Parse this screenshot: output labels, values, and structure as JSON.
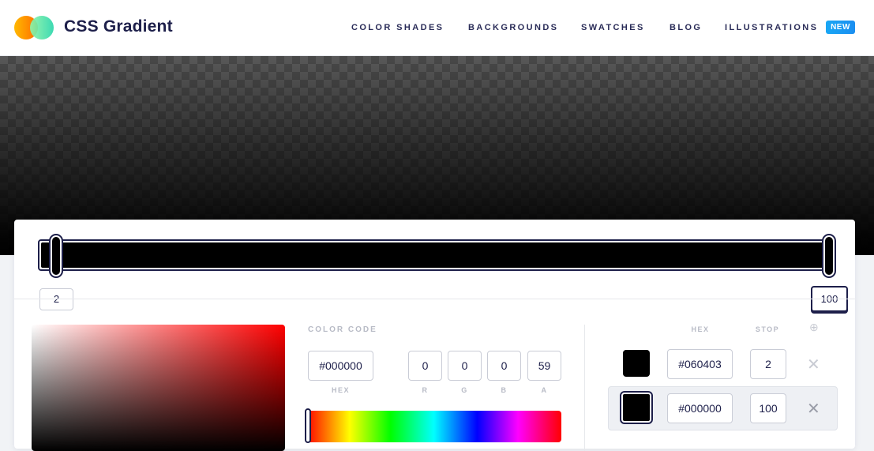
{
  "header": {
    "brand": "CSS Gradient",
    "nav": [
      "COLOR SHADES",
      "BACKGROUNDS",
      "SWATCHES",
      "BLOG",
      "ILLUSTRATIONS"
    ],
    "badge": "NEW"
  },
  "slider": {
    "stops": [
      "2",
      "100"
    ]
  },
  "color_code": {
    "label": "COLOR CODE",
    "hex": "#000000",
    "hex_label": "HEX",
    "r": "0",
    "g": "0",
    "b": "0",
    "a": "59",
    "r_label": "R",
    "g_label": "G",
    "b_label": "B",
    "a_label": "A"
  },
  "stops_table": {
    "headers": {
      "hex": "HEX",
      "stop": "STOP"
    },
    "rows": [
      {
        "hex": "#060403",
        "stop": "2"
      },
      {
        "hex": "#000000",
        "stop": "100"
      }
    ],
    "add_icon": "⊕",
    "remove_icon": "✕"
  },
  "colors": {
    "navy": "#1d1f4a",
    "badge": "#1b8ef0"
  }
}
